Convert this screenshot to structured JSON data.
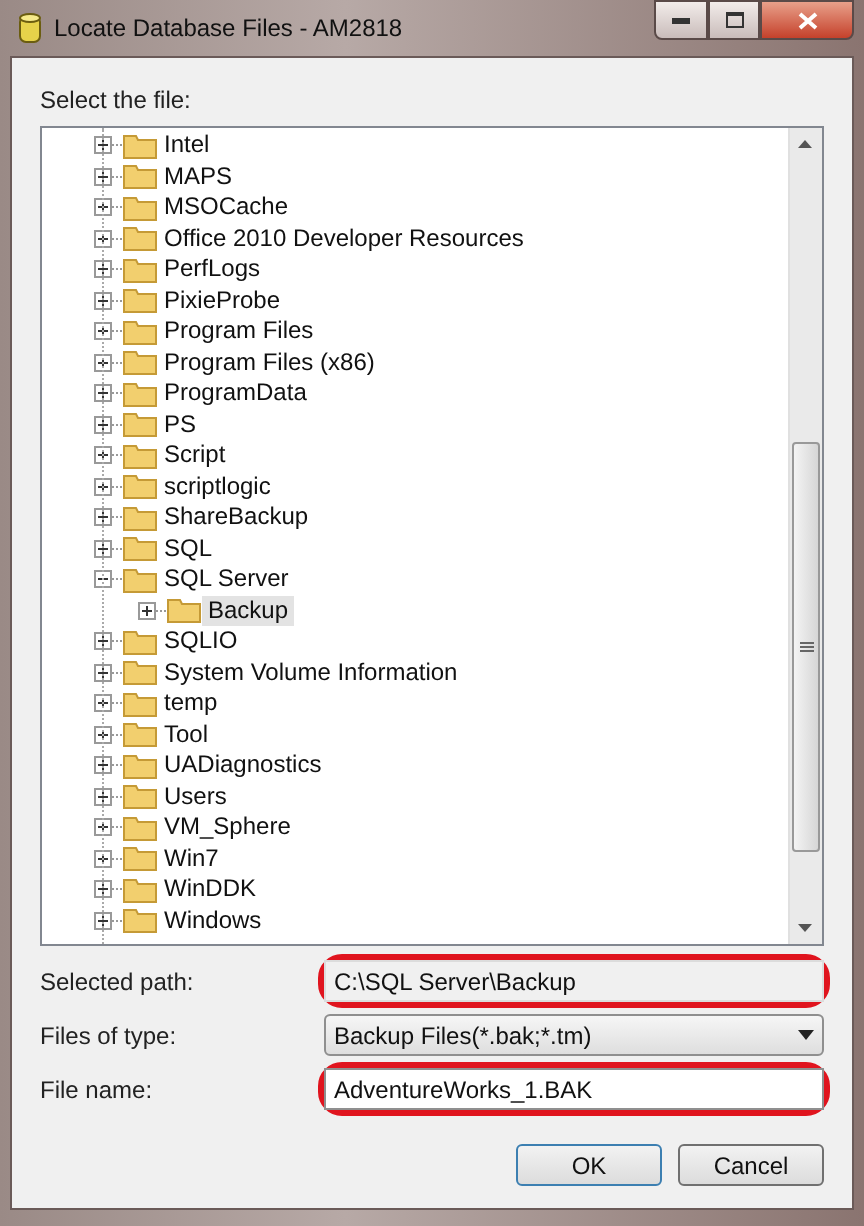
{
  "window": {
    "title": "Locate Database Files - AM2818"
  },
  "tree": {
    "label": "Select the file:",
    "items": [
      {
        "label": "Intel",
        "expanded": false,
        "selected": false
      },
      {
        "label": "MAPS",
        "expanded": false,
        "selected": false
      },
      {
        "label": "MSOCache",
        "expanded": false,
        "selected": false
      },
      {
        "label": "Office 2010 Developer Resources",
        "expanded": false,
        "selected": false
      },
      {
        "label": "PerfLogs",
        "expanded": false,
        "selected": false
      },
      {
        "label": "PixieProbe",
        "expanded": false,
        "selected": false
      },
      {
        "label": "Program Files",
        "expanded": false,
        "selected": false
      },
      {
        "label": "Program Files (x86)",
        "expanded": false,
        "selected": false
      },
      {
        "label": "ProgramData",
        "expanded": false,
        "selected": false
      },
      {
        "label": "PS",
        "expanded": false,
        "selected": false
      },
      {
        "label": "Script",
        "expanded": false,
        "selected": false
      },
      {
        "label": "scriptlogic",
        "expanded": false,
        "selected": false
      },
      {
        "label": "ShareBackup",
        "expanded": false,
        "selected": false
      },
      {
        "label": "SQL",
        "expanded": false,
        "selected": false
      },
      {
        "label": "SQL Server",
        "expanded": true,
        "selected": false,
        "children": [
          {
            "label": "Backup",
            "expanded": false,
            "selected": true
          }
        ]
      },
      {
        "label": "SQLIO",
        "expanded": false,
        "selected": false
      },
      {
        "label": "System Volume Information",
        "expanded": false,
        "selected": false
      },
      {
        "label": "temp",
        "expanded": false,
        "selected": false
      },
      {
        "label": "Tool",
        "expanded": false,
        "selected": false
      },
      {
        "label": "UADiagnostics",
        "expanded": false,
        "selected": false
      },
      {
        "label": "Users",
        "expanded": false,
        "selected": false
      },
      {
        "label": "VM_Sphere",
        "expanded": false,
        "selected": false
      },
      {
        "label": "Win7",
        "expanded": false,
        "selected": false
      },
      {
        "label": "WinDDK",
        "expanded": false,
        "selected": false
      },
      {
        "label": "Windows",
        "expanded": false,
        "selected": false
      }
    ]
  },
  "fields": [
    {
      "kind": "readonly",
      "label": "Selected path:",
      "value": "C:\\SQL Server\\Backup",
      "highlighted": true
    },
    {
      "kind": "dropdown",
      "label": "Files of type:",
      "value": "Backup Files(*.bak;*.tm)",
      "highlighted": false
    },
    {
      "kind": "text",
      "label": "File name:",
      "value": "AdventureWorks_1.BAK",
      "highlighted": true
    }
  ],
  "buttons": [
    {
      "label": "OK",
      "default": true
    },
    {
      "label": "Cancel",
      "default": false
    }
  ]
}
